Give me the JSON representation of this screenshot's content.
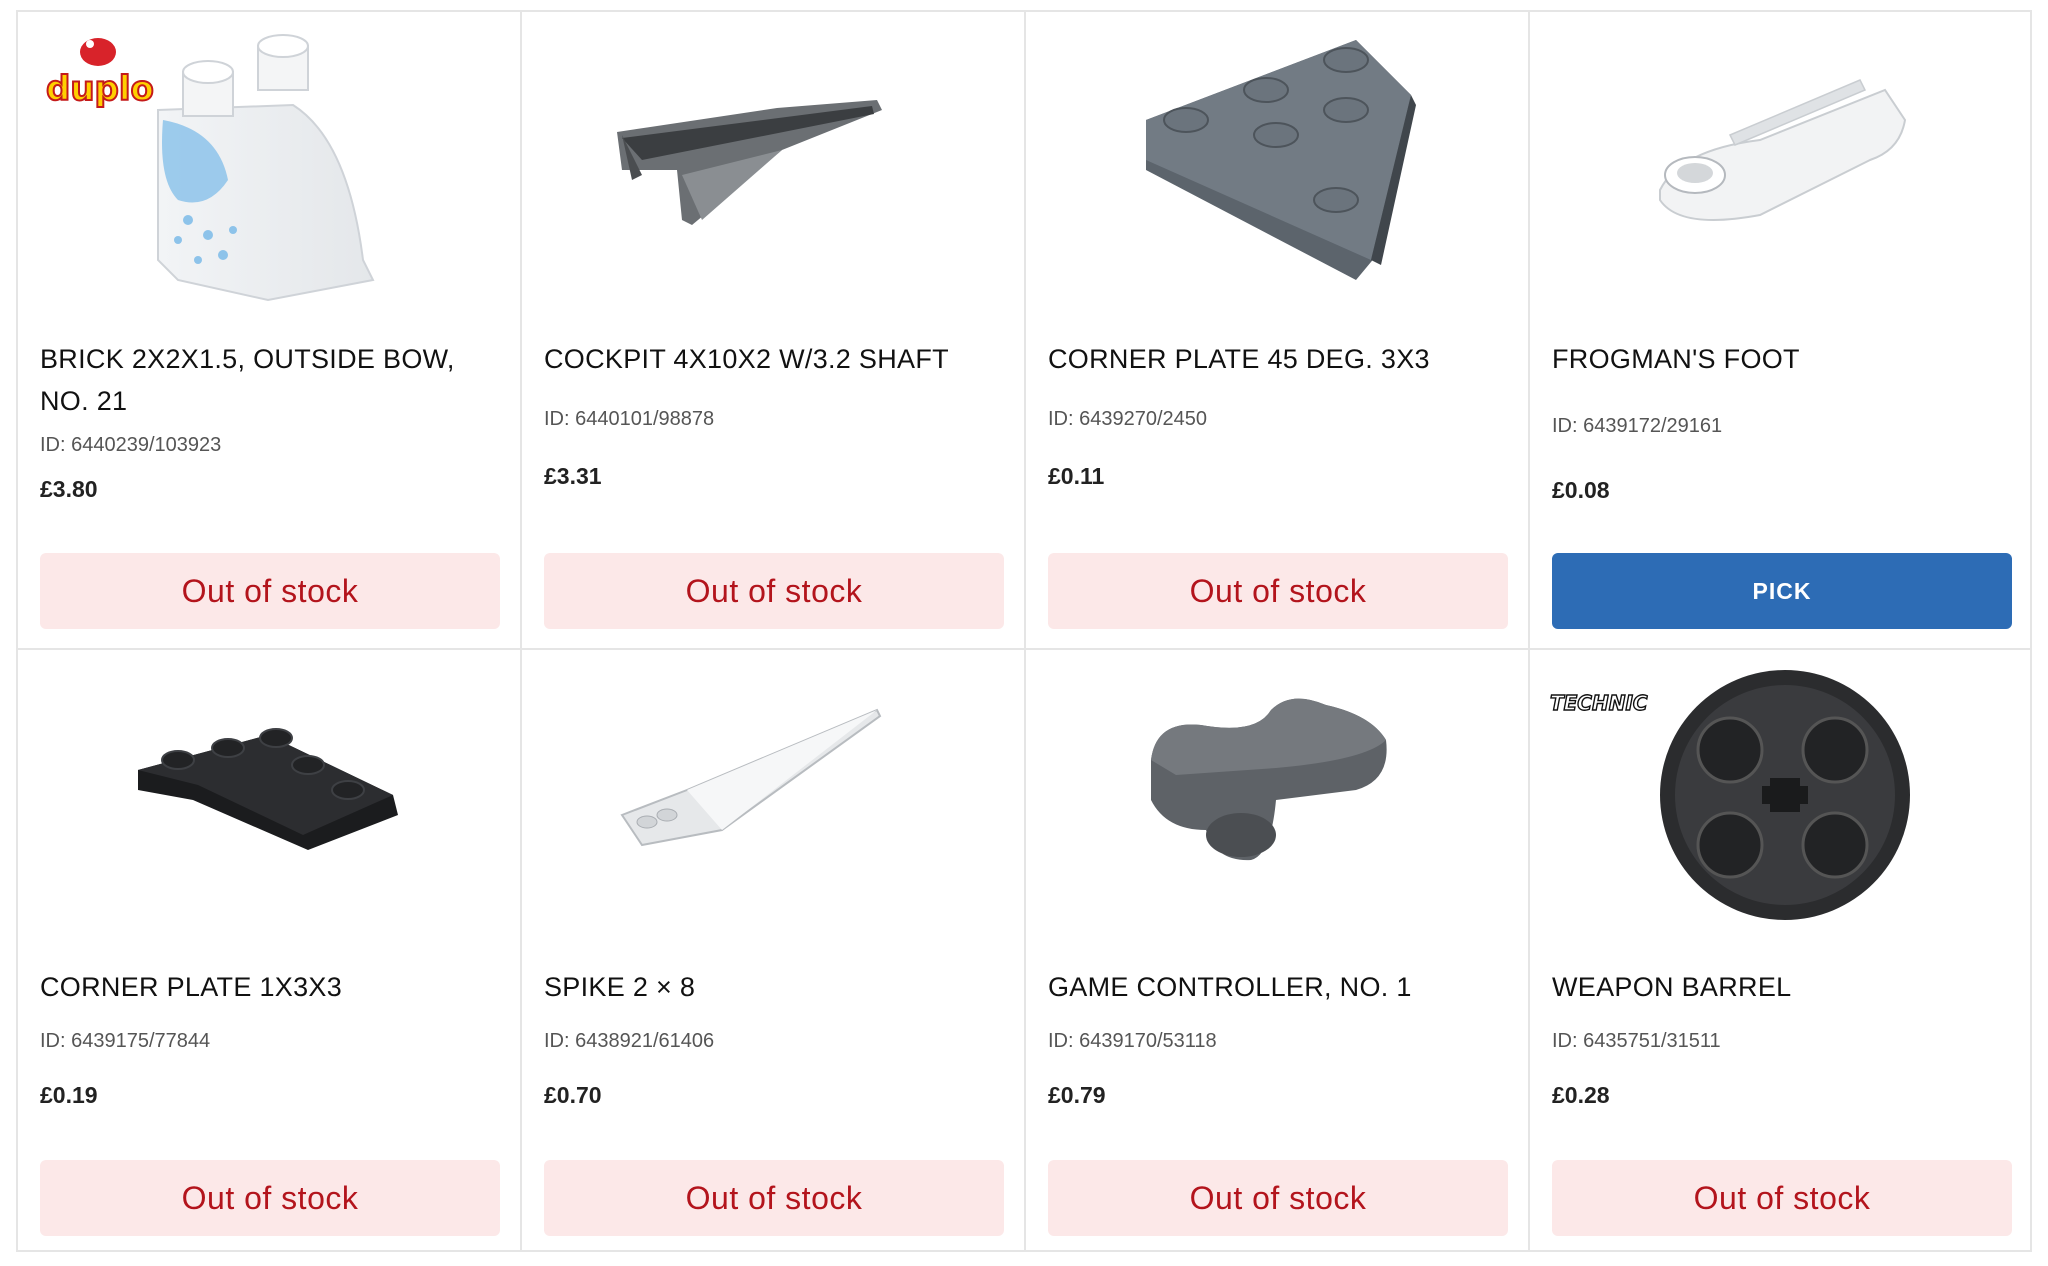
{
  "products": [
    {
      "title": "BRICK 2X2X1.5, OUTSIDE BOW, NO. 21",
      "id": "ID: 6440239/103923",
      "price": "£3.80",
      "button": "Out of stock",
      "brand": "duplo"
    },
    {
      "title": "COCKPIT 4X10X2 W/3.2 SHAFT",
      "id": "ID: 6440101/98878",
      "price": "£3.31",
      "button": "Out of stock"
    },
    {
      "title": "CORNER PLATE 45 DEG. 3X3",
      "id": "ID: 6439270/2450",
      "price": "£0.11",
      "button": "Out of stock"
    },
    {
      "title": "FROGMAN'S FOOT",
      "id": "ID: 6439172/29161",
      "price": "£0.08",
      "button": "PICK"
    },
    {
      "title": "CORNER PLATE 1X3X3",
      "id": "ID: 6439175/77844",
      "price": "£0.19",
      "button": "Out of stock"
    },
    {
      "title": "SPIKE 2 × 8",
      "id": "ID: 6438921/61406",
      "price": "£0.70",
      "button": "Out of stock"
    },
    {
      "title": "GAME CONTROLLER, NO. 1",
      "id": "ID: 6439170/53118",
      "price": "£0.79",
      "button": "Out of stock"
    },
    {
      "title": "WEAPON BARREL",
      "id": "ID: 6435751/31511",
      "price": "£0.28",
      "button": "Out of stock",
      "brand": "TECHNIC"
    }
  ],
  "colors": {
    "out_of_stock_bg": "#fce8e8",
    "out_of_stock_text": "#b3141c",
    "pick_bg": "#2d6cb5"
  }
}
